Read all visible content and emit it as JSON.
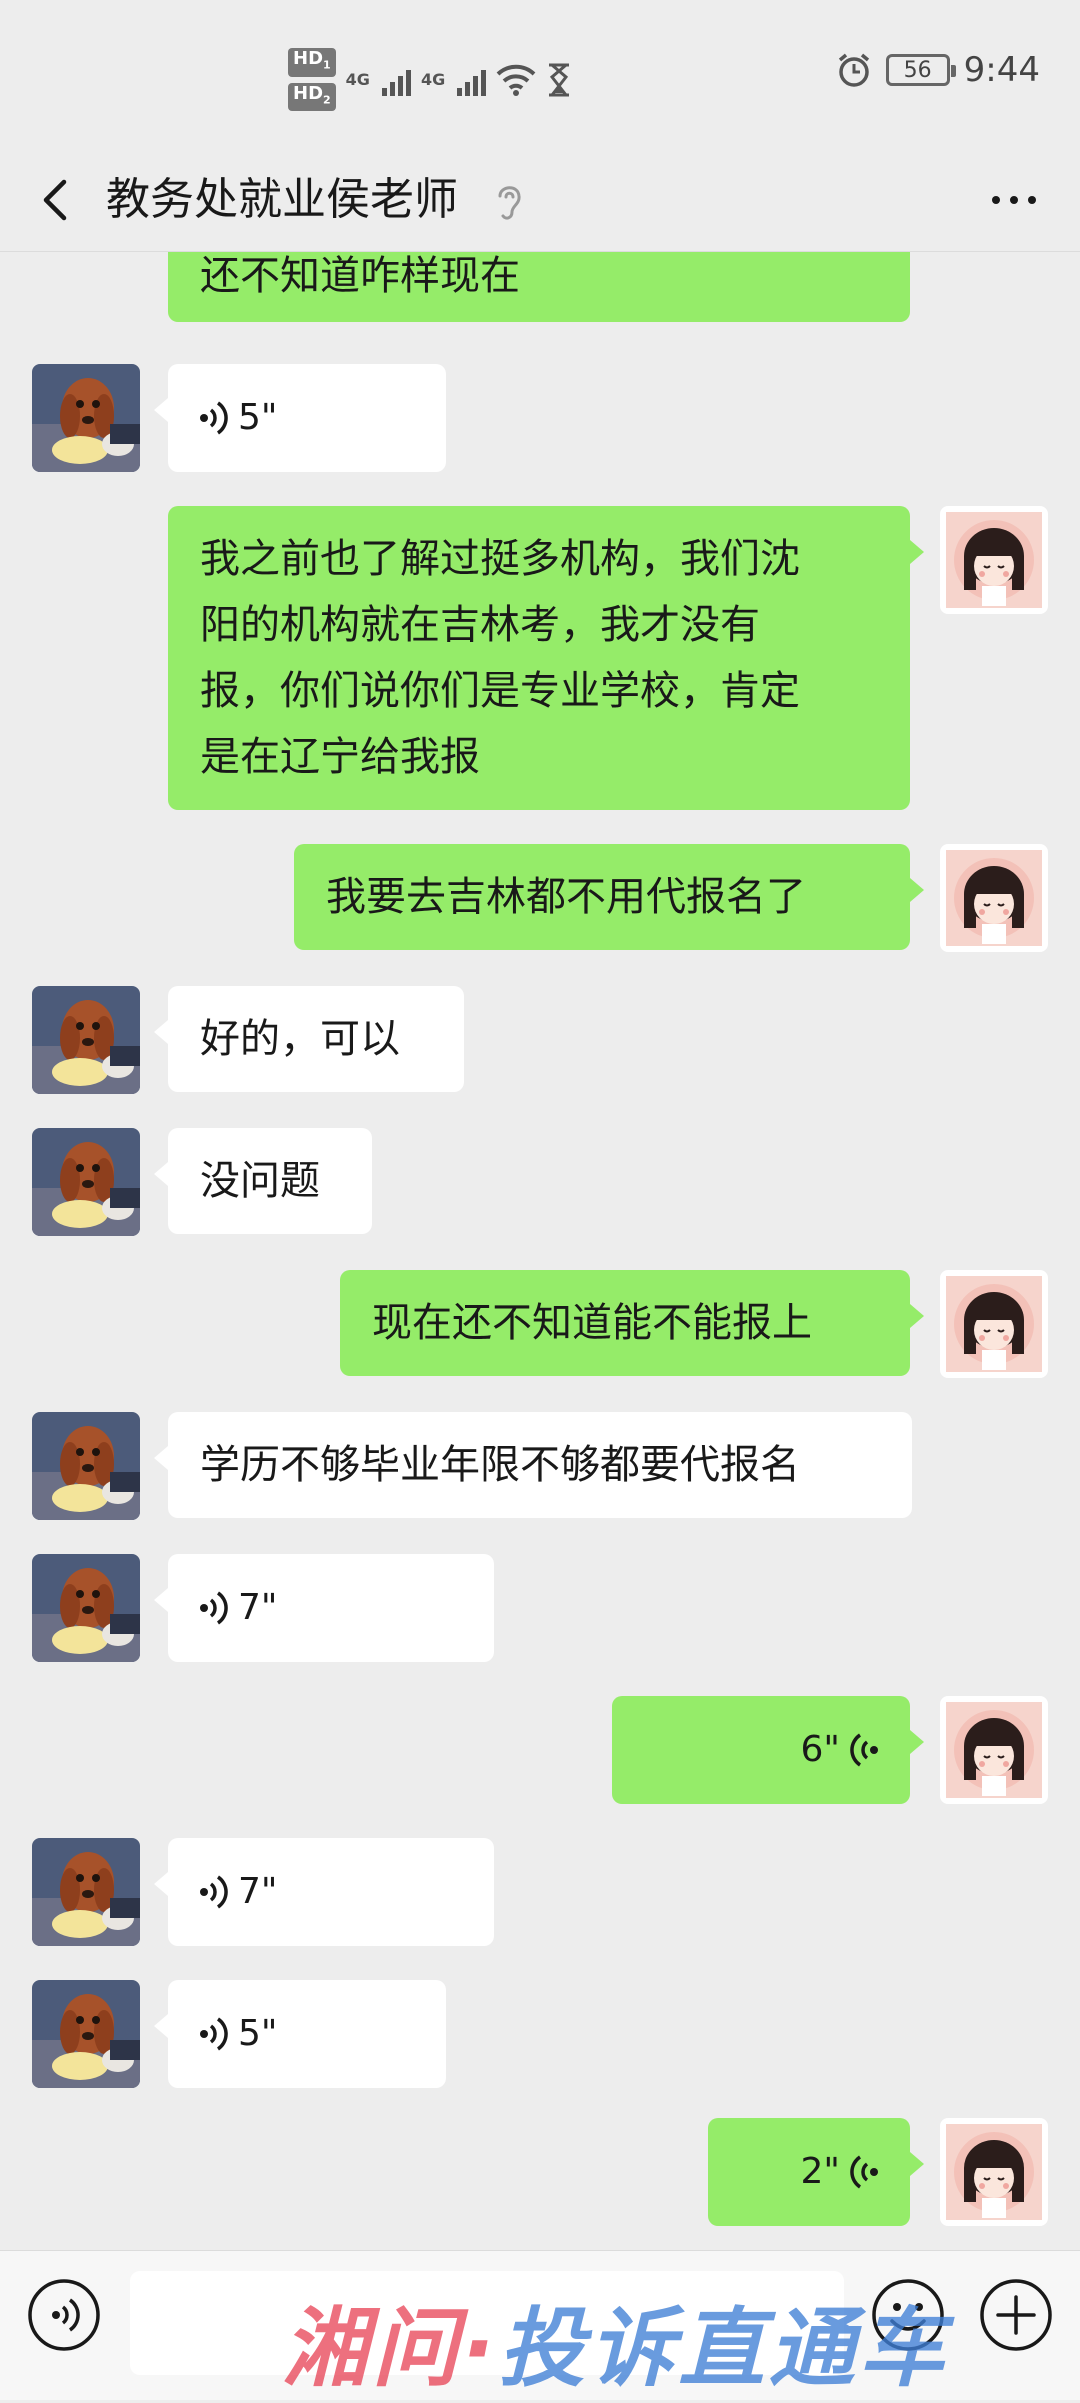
{
  "status_bar": {
    "hd1": "HD",
    "hd1_sub": "1",
    "hd2": "HD",
    "hd2_sub": "2",
    "net1": "4G",
    "net2": "4G",
    "battery": "56",
    "time": "9:44"
  },
  "header": {
    "title": "教务处就业侯老师",
    "icons": [
      "back-icon",
      "ear-icon",
      "more-icon"
    ]
  },
  "messages": [
    {
      "side": "right",
      "type": "text",
      "text": "还不知道咋样现在"
    },
    {
      "side": "left",
      "type": "voice",
      "duration": "5\""
    },
    {
      "side": "right",
      "type": "text",
      "lines": [
        "我之前也了解过挺多机构，我们沈",
        "阳的机构就在吉林考，我才没有",
        "报，你们说你们是专业学校，肯定",
        "是在辽宁给我报"
      ]
    },
    {
      "side": "right",
      "type": "text",
      "text": "我要去吉林都不用代报名了"
    },
    {
      "side": "left",
      "type": "text",
      "text": "好的，可以"
    },
    {
      "side": "left",
      "type": "text",
      "text": "没问题"
    },
    {
      "side": "right",
      "type": "text",
      "text": "现在还不知道能不能报上"
    },
    {
      "side": "left",
      "type": "text",
      "text": "学历不够毕业年限不够都要代报名"
    },
    {
      "side": "left",
      "type": "voice",
      "duration": "7\""
    },
    {
      "side": "right",
      "type": "voice",
      "duration": "6\""
    },
    {
      "side": "left",
      "type": "voice",
      "duration": "7\""
    },
    {
      "side": "left",
      "type": "voice",
      "duration": "5\""
    },
    {
      "side": "right",
      "type": "voice",
      "duration": "2\""
    }
  ],
  "input_bar": {
    "placeholder": "",
    "icons": [
      "voice-toggle-icon",
      "emoji-icon",
      "plus-icon"
    ]
  },
  "watermark": {
    "red": "湘问·",
    "blue": "投诉直通车"
  },
  "colors": {
    "background": "#ededed",
    "bubble_green": "#95ec69",
    "bubble_white": "#ffffff"
  }
}
